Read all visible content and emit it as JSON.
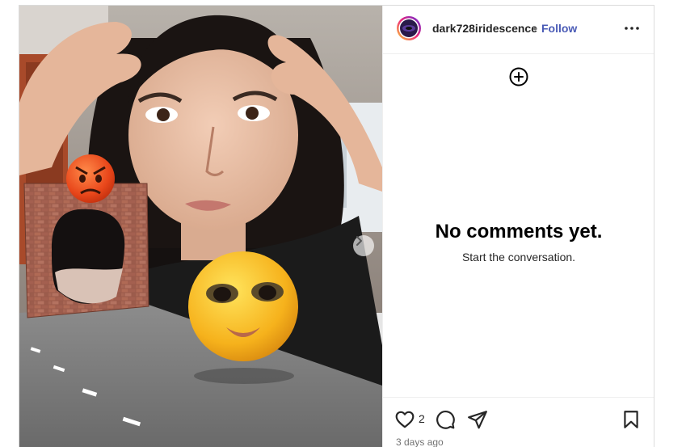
{
  "post": {
    "username": "dark728iridescence",
    "separator": "•",
    "follow_label": "Follow",
    "like_count": "2",
    "timestamp": "3 days ago"
  },
  "comments": {
    "empty_title": "No comments yet.",
    "empty_subtitle": "Start the conversation."
  },
  "icons": {
    "avatar": "avatar-ring",
    "more": "more-options-icon",
    "add": "add-comment-icon",
    "next": "chevron-right-icon",
    "like": "heart-icon",
    "comment": "comment-icon",
    "share": "share-icon",
    "save": "bookmark-icon"
  },
  "colors": {
    "follow": "#4a5bb6",
    "text": "#262626",
    "muted": "#737373",
    "divider": "#efefef"
  }
}
